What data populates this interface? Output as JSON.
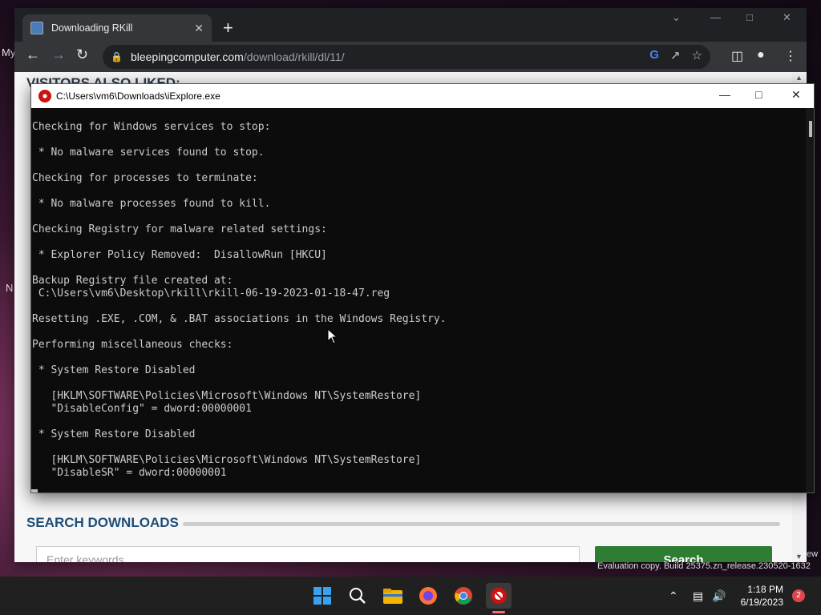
{
  "desktop": {
    "edge_text_top": "My",
    "edge_text_mid": "N",
    "edge_text_right": "ew"
  },
  "browser": {
    "tab_title": "Downloading RKill",
    "tab_close": "✕",
    "new_tab": "+",
    "url_host": "bleepingcomputer.com",
    "url_path": "/download/rkill/dl/11/",
    "page": {
      "visitors_heading": "VISITORS ALSO LIKED:",
      "search_heading": "SEARCH DOWNLOADS",
      "keyword_placeholder": "Enter keywords",
      "search_button": "Search"
    }
  },
  "console": {
    "title": "C:\\Users\\vm6\\Downloads\\iExplore.exe",
    "lines": [
      "Checking for Windows services to stop:",
      "",
      " * No malware services found to stop.",
      "",
      "Checking for processes to terminate:",
      "",
      " * No malware processes found to kill.",
      "",
      "Checking Registry for malware related settings:",
      "",
      " * Explorer Policy Removed:  DisallowRun [HKCU]",
      "",
      "Backup Registry file created at:",
      " C:\\Users\\vm6\\Desktop\\rkill\\rkill-06-19-2023-01-18-47.reg",
      "",
      "Resetting .EXE, .COM, & .BAT associations in the Windows Registry.",
      "",
      "Performing miscellaneous checks:",
      "",
      " * System Restore Disabled",
      "",
      "   [HKLM\\SOFTWARE\\Policies\\Microsoft\\Windows NT\\SystemRestore]",
      "   \"DisableConfig\" = dword:00000001",
      "",
      " * System Restore Disabled",
      "",
      "   [HKLM\\SOFTWARE\\Policies\\Microsoft\\Windows NT\\SystemRestore]",
      "   \"DisableSR\" = dword:00000001"
    ]
  },
  "taskbar": {
    "time": "1:18 PM",
    "date": "6/19/2023",
    "notification_count": "2",
    "watermark": "Evaluation copy. Build 25375.zn_release.230520-1632"
  },
  "colors": {
    "console_bg": "#0c0c0c",
    "console_text": "#cccccc",
    "search_button": "#2e7d32",
    "heading_blue": "#1f4e79"
  }
}
